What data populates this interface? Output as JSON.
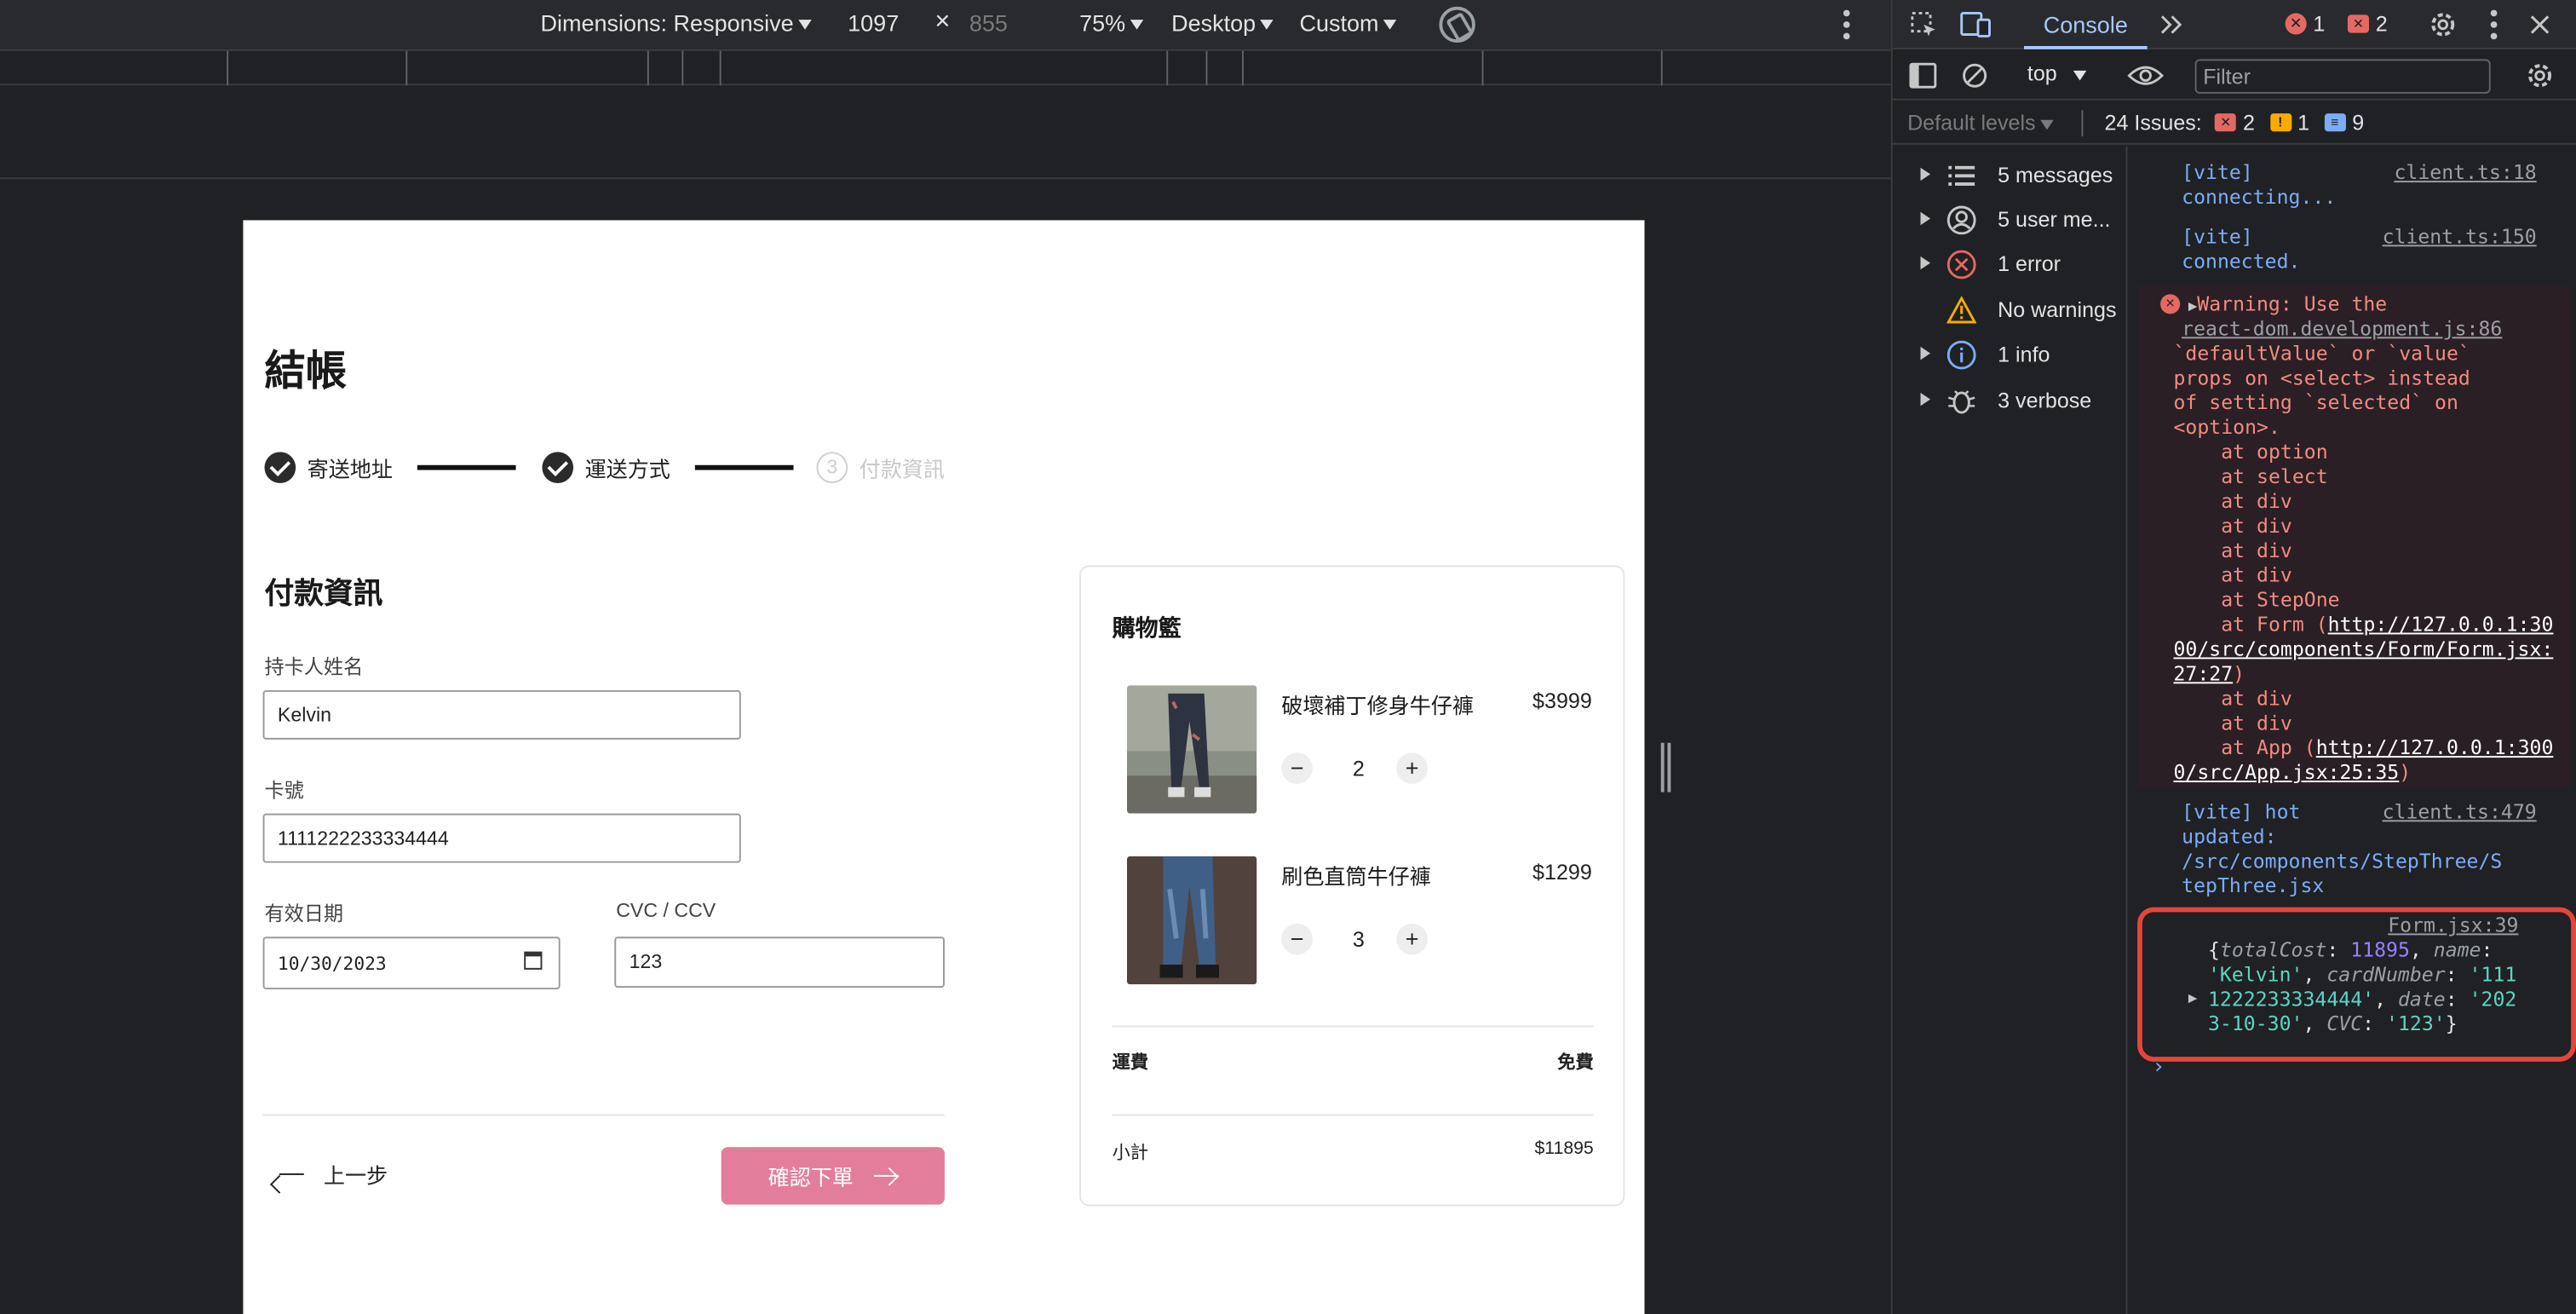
{
  "device_toolbar": {
    "dimensions_label": "Dimensions: Responsive",
    "width": "1097",
    "times": "×",
    "height": "855",
    "zoom": "75%",
    "device_type": "Desktop",
    "throttle": "Custom"
  },
  "page": {
    "title": "結帳",
    "steps": [
      {
        "label": "寄送地址",
        "state": "done"
      },
      {
        "label": "運送方式",
        "state": "done"
      },
      {
        "label": "付款資訊",
        "number": "3",
        "state": "inactive"
      }
    ],
    "form": {
      "section_title": "付款資訊",
      "name_label": "持卡人姓名",
      "name_value": "Kelvin",
      "card_label": "卡號",
      "card_value": "1111222233334444",
      "date_label": "有效日期",
      "date_value": "10/30/2023",
      "cvc_label": "CVC / CCV",
      "cvc_value": "123"
    },
    "back_label": "上一步",
    "confirm_label": "確認下單",
    "cart": {
      "title": "購物籃",
      "items": [
        {
          "name": "破壞補丁修身牛仔褲",
          "price": "$3999",
          "qty": "2",
          "minus": "−",
          "plus": "+"
        },
        {
          "name": "刷色直筒牛仔褲",
          "price": "$1299",
          "qty": "3",
          "minus": "−",
          "plus": "+"
        }
      ],
      "shipping_label": "運費",
      "shipping_value": "免費",
      "subtotal_label": "小計",
      "subtotal_value": "$11895"
    }
  },
  "devtools": {
    "active_tab": "Console",
    "error_count": "1",
    "issue_badge_count": "2",
    "context": "top",
    "filter_placeholder": "Filter",
    "levels_label": "Default levels",
    "issues_label": "24 Issues:",
    "issues_errors": "2",
    "issues_warnings": "1",
    "issues_info": "9",
    "sidebar": [
      {
        "label": "5 messages",
        "icon": "list-icon"
      },
      {
        "label": "5 user me...",
        "icon": "user-icon"
      },
      {
        "label": "1 error",
        "icon": "error-icon"
      },
      {
        "label": "No warnings",
        "icon": "warning-icon"
      },
      {
        "label": "1 info",
        "icon": "info-icon"
      },
      {
        "label": "3 verbose",
        "icon": "bug-icon"
      }
    ],
    "messages": {
      "m1_text": "[vite]\nconnecting...",
      "m1_src": "client.ts:18",
      "m2_text": "[vite]\nconnected.",
      "m2_src": "client.ts:150",
      "warn_line1": "Warning: Use the",
      "warn_src": "react-dom.development.js:86",
      "warn_body": "`defaultValue` or `value`\nprops on <select> instead\nof setting `selected` on\n<option>.\n    at option\n    at select\n    at div\n    at div\n    at div\n    at div\n    at StepOne\n    at Form (",
      "warn_link1": "http://127.0.0.1:3000/src/components/Form/Form.jsx:27:27",
      "warn_tail": "    at div\n    at div\n    at App (",
      "warn_link2": "http://127.0.0.1:3000/src/App.jsx:25:35",
      "m4_text": "[vite] hot\nupdated:\n/src/components/StepThree/S\ntepThree.jsx",
      "m4_src": "client.ts:479",
      "log_src": "Form.jsx:39",
      "log_total_key": "totalCost",
      "log_total": "11895",
      "log_name_key": "name",
      "log_name": "'Kelvin'",
      "log_card_key": "cardNumber",
      "log_card": "'1111222233334444'",
      "log_date_key": "date",
      "log_date": "'2023-10-30'",
      "log_cvc_key": "CVC",
      "log_cvc": "'123'"
    }
  }
}
